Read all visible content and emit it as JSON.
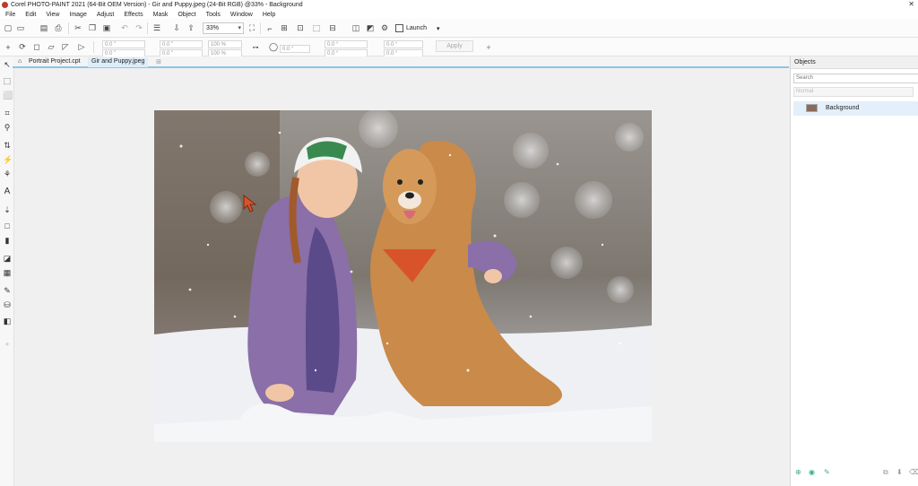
{
  "window": {
    "title": "Corel PHOTO-PAINT 2021 (64-Bit OEM Version) - Gir and Puppy.jpeg (24-Bit RGB) @33% - Background",
    "close_glyph": "✕"
  },
  "menu": [
    "File",
    "Edit",
    "View",
    "Image",
    "Adjust",
    "Effects",
    "Mask",
    "Object",
    "Tools",
    "Window",
    "Help"
  ],
  "toolbar": {
    "zoom_value": "33%",
    "launch_label": "Launch"
  },
  "property_bar": {
    "x_value": "0.0 \"",
    "y_value": "0.0 \"",
    "w_value": "0.0 \"",
    "h_value": "0.0 \"",
    "scale_w": "100 %",
    "scale_h": "100 %",
    "angle_value": "0.0 °",
    "skew_h": "0.0 °",
    "skew_v": "0.0 °",
    "offset_h": "0.0 °",
    "offset_v": "0.0 °",
    "apply_label": "Apply"
  },
  "tabs": [
    {
      "label": "Portrait Project.cpt",
      "active": false
    },
    {
      "label": "Gir and Puppy.jpeg",
      "active": true
    }
  ],
  "objects_panel": {
    "title": "Objects",
    "search_placeholder": "Search",
    "blend_mode": "Normal",
    "layers": [
      {
        "name": "Background",
        "selected": true
      }
    ]
  },
  "colors": {
    "accent": "#8fc4e8",
    "selected_row": "#e3f0fb",
    "scarf": "#5a4a8a",
    "dog": "#c98a4a",
    "bandana": "#d9532a"
  }
}
